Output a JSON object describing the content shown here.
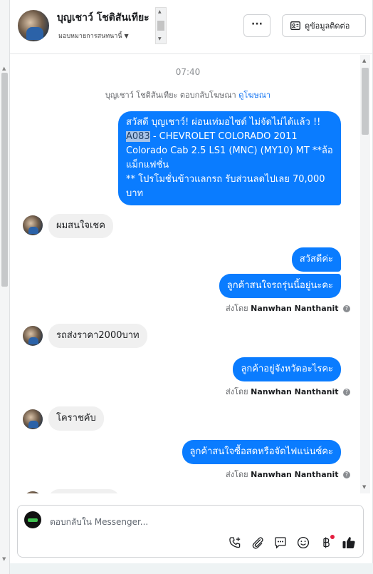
{
  "header": {
    "contact_name": "บุญเชาว์ โชติสันเทียะ",
    "assign_label": "มอบหมายการสนทนานี้",
    "more_label": "···",
    "view_contact_label": "ดูข้อมูลติดต่อ"
  },
  "chat": {
    "time": "07:40",
    "reply_note": {
      "text": "บุญเชาว์ โชติสันเทียะ ตอบกลับโฆษณา",
      "link": "ดูโฆษณา"
    },
    "ad_message": {
      "line1": "สวัสดี บุญเชาว์! ผ่อนเท่มอไซด์ ไม่จัดไม่ได้แล้ว !!",
      "code": "A083",
      "line2_rest": " - CHEVROLET COLORADO 2011",
      "line3": "Colorado Cab 2.5 LS1 (MNC) (MY10) MT **ล้อ",
      "line4": "แม็กแฟชั่น",
      "line5": "** โปรโมชั่นข้าวแลกรถ รับส่วนลดไปเลย 70,000",
      "line6": "บาท"
    },
    "messages": [
      {
        "dir": "in",
        "text": "ผมสนใจเชค"
      },
      {
        "dir": "out",
        "text": "สวัสดีค่ะ"
      },
      {
        "dir": "out",
        "text": "ลูกค้าสนใจรถรุ่นนี้อยู่นะคะ"
      },
      {
        "dir": "in",
        "text": "รถส่งราคา2000บาท"
      },
      {
        "dir": "out",
        "text": "ลูกค้าอยู่จังหวัดอะไรคะ"
      },
      {
        "dir": "in",
        "text": "โคราชคับ"
      },
      {
        "dir": "out",
        "text": "ลูกค้าสนใจซื้อสดหรือจัดไฟแน่นซ์คะ"
      }
    ],
    "sent_by_prefix": "ส่งโดย",
    "sent_by_name": "Nanwhan Nanthanit"
  },
  "composer": {
    "placeholder": "ตอบกลับใน Messenger..."
  },
  "colors": {
    "outgoing_bubble": "#0a7cff",
    "incoming_bubble": "#f0f0f0",
    "accent_link": "#1877f2",
    "notification_dot": "#e41e3f"
  },
  "icons": [
    "more-icon",
    "contact-card-icon",
    "phone-add-icon",
    "attachment-icon",
    "saved-replies-icon",
    "emoji-icon",
    "baht-icon",
    "thumbs-up-icon"
  ]
}
